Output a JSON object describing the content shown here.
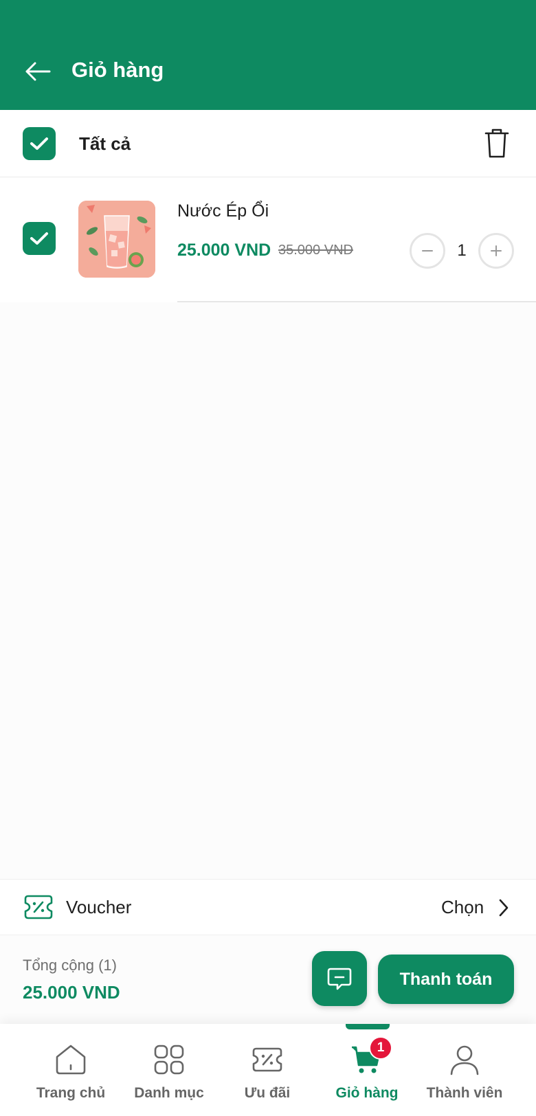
{
  "header": {
    "title": "Giỏ hàng"
  },
  "select_all": {
    "label": "Tất cả",
    "checked": true
  },
  "cart": {
    "items": [
      {
        "name": "Nước Ép Ổi",
        "price": "25.000 VND",
        "old_price": "35.000 VND",
        "quantity": "1",
        "checked": true
      }
    ]
  },
  "voucher": {
    "label": "Voucher",
    "action": "Chọn"
  },
  "summary": {
    "label": "Tổng cộng (1)",
    "total": "25.000 VND",
    "checkout_label": "Thanh toán"
  },
  "bottom_nav": {
    "items": [
      {
        "label": "Trang chủ",
        "icon": "home-icon"
      },
      {
        "label": "Danh mục",
        "icon": "grid-icon"
      },
      {
        "label": "Ưu đãi",
        "icon": "ticket-icon"
      },
      {
        "label": "Giỏ hàng",
        "icon": "cart-icon",
        "active": true,
        "badge": "1"
      },
      {
        "label": "Thành viên",
        "icon": "user-icon"
      }
    ]
  },
  "colors": {
    "primary": "#0e8a61",
    "badge": "#e4163a",
    "text": "#1f1f1f",
    "muted": "#6e6e6e"
  }
}
